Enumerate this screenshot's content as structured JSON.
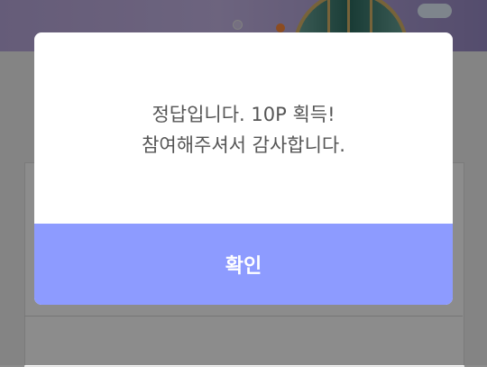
{
  "dialog": {
    "message_line1": "정답입니다. 10P 획득!",
    "message_line2": "참여해주셔서 감사합니다.",
    "confirm_label": "확인"
  },
  "colors": {
    "confirm_button": "#8d9bff",
    "message_text": "#555555",
    "overlay": "rgba(0,0,0,0.45)"
  }
}
